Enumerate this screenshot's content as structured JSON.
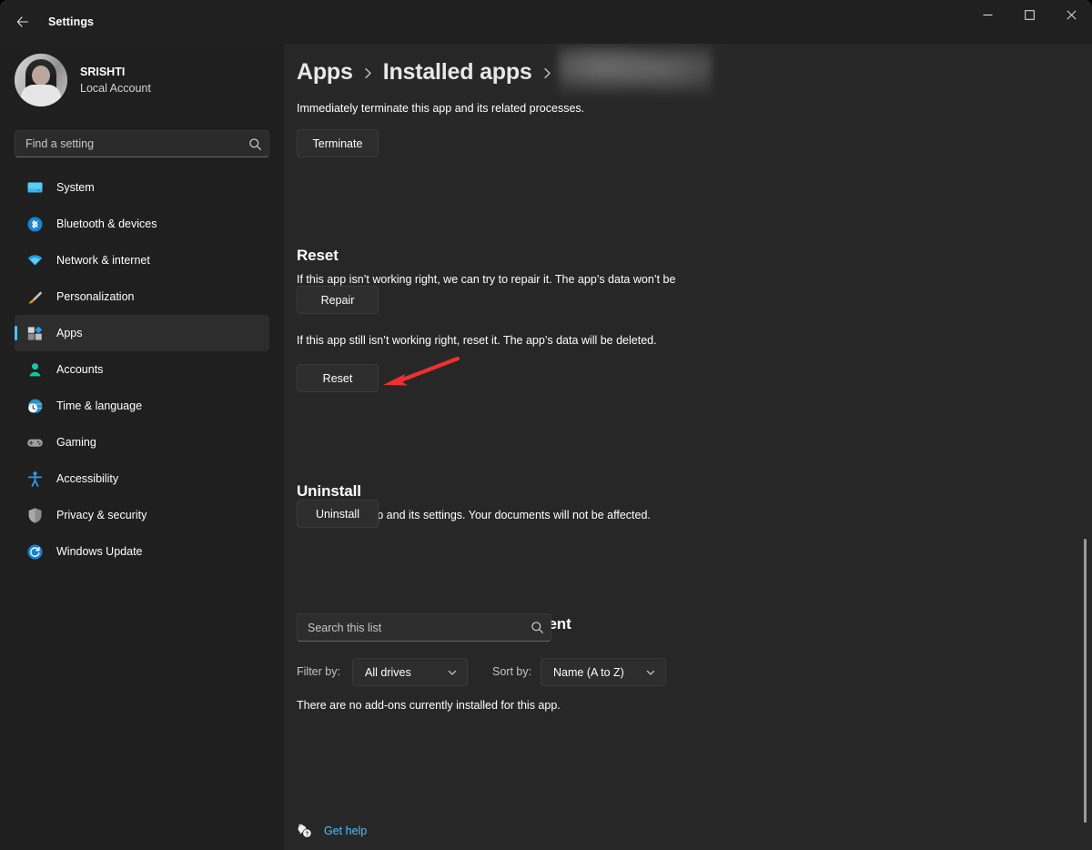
{
  "window": {
    "title": "Settings",
    "back_icon": "back-arrow-icon",
    "controls": {
      "minimize": "minimize-icon",
      "maximize": "maximize-icon",
      "close": "close-icon"
    }
  },
  "sidebar": {
    "account": {
      "name": "SRISHTI",
      "type": "Local Account",
      "avatar": "user-avatar"
    },
    "search": {
      "placeholder": "Find a setting",
      "value": "",
      "icon": "search-icon"
    },
    "items": [
      {
        "label": "System",
        "icon": "system-monitor-icon",
        "selected": false
      },
      {
        "label": "Bluetooth & devices",
        "icon": "bluetooth-icon",
        "selected": false
      },
      {
        "label": "Network & internet",
        "icon": "wifi-icon",
        "selected": false
      },
      {
        "label": "Personalization",
        "icon": "paintbrush-icon",
        "selected": false
      },
      {
        "label": "Apps",
        "icon": "apps-icon",
        "selected": true
      },
      {
        "label": "Accounts",
        "icon": "person-icon",
        "selected": false
      },
      {
        "label": "Time & language",
        "icon": "clock-globe-icon",
        "selected": false
      },
      {
        "label": "Gaming",
        "icon": "gamepad-icon",
        "selected": false
      },
      {
        "label": "Accessibility",
        "icon": "accessibility-icon",
        "selected": false
      },
      {
        "label": "Privacy & security",
        "icon": "shield-icon",
        "selected": false
      },
      {
        "label": "Windows Update",
        "icon": "update-refresh-icon",
        "selected": false
      }
    ]
  },
  "main": {
    "breadcrumb": {
      "crumb1": "Apps",
      "crumb2": "Installed apps",
      "crumb3": "",
      "separator": "chevron-right-icon",
      "crumb3_redacted": true
    },
    "terminate": {
      "description": "Immediately terminate this app and its related processes.",
      "button": "Terminate"
    },
    "reset": {
      "heading": "Reset",
      "repair_description": "If this app isn’t working right, we can try to repair it. The app’s data won’t be affected.",
      "repair_button": "Repair",
      "reset_description": "If this app still isn’t working right, reset it. The app’s data will be deleted.",
      "reset_button": "Reset"
    },
    "uninstall": {
      "heading": "Uninstall",
      "description": "Uninstall this app and its settings. Your documents will not be affected.",
      "button": "Uninstall"
    },
    "addons": {
      "heading": "App add-ons & downloadable content",
      "search_placeholder": "Search this list",
      "search_value": "",
      "search_icon": "search-icon",
      "filter_label": "Filter by:",
      "filter_value": "All drives",
      "sort_label": "Sort by:",
      "sort_value": "Name (A to Z)",
      "dropdown_icon": "chevron-down-icon",
      "empty_message": "There are no add-ons currently installed for this app."
    },
    "footer": {
      "help_text": "Get help",
      "help_icon": "help-question-icon"
    }
  },
  "annotation": {
    "arrow_color": "#f0302f",
    "target": "reset-button"
  },
  "colors": {
    "accent": "#4cc2ff",
    "sidebar_bg": "#1f1f1f",
    "content_bg": "#272727",
    "titlebar_bg": "#202020",
    "button_bg": "#2d2d2d",
    "link": "#4cc2ff"
  }
}
